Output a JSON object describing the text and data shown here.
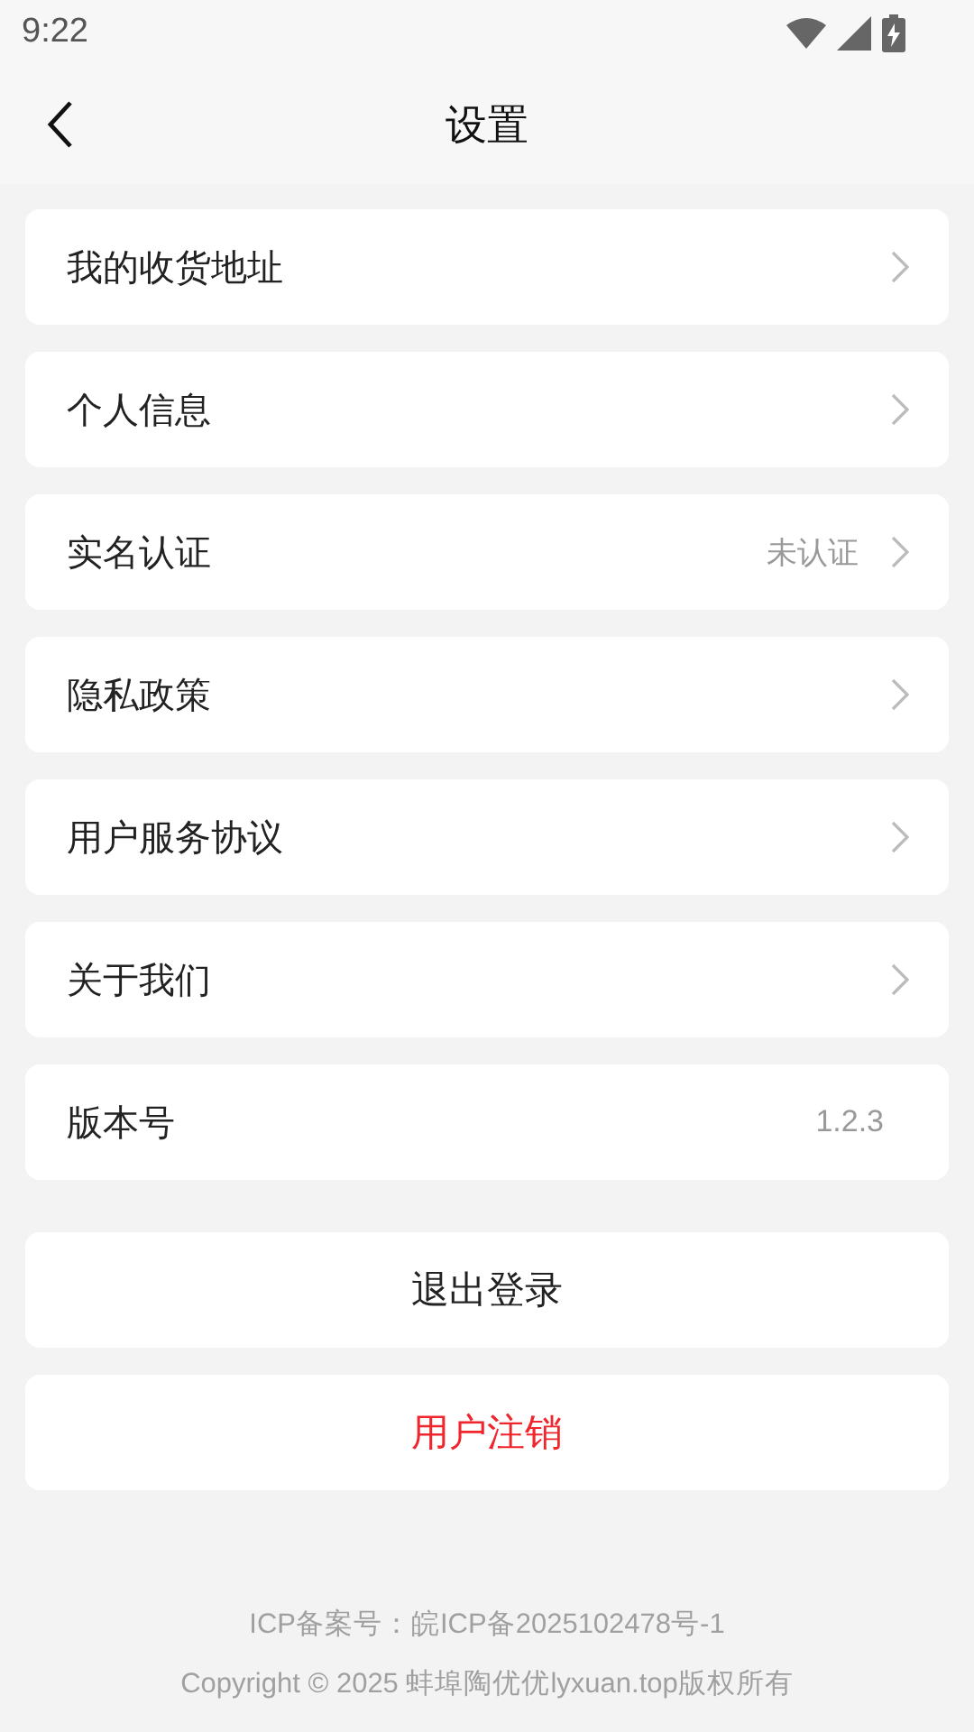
{
  "status_bar": {
    "time": "9:22"
  },
  "header": {
    "title": "设置"
  },
  "items": [
    {
      "kind": "link",
      "label": "我的收货地址"
    },
    {
      "kind": "link",
      "label": "个人信息"
    },
    {
      "kind": "link",
      "label": "实名认证",
      "value": "未认证"
    },
    {
      "kind": "link",
      "label": "隐私政策"
    },
    {
      "kind": "link",
      "label": "用户服务协议"
    },
    {
      "kind": "link",
      "label": "关于我们"
    },
    {
      "kind": "info",
      "label": "版本号",
      "value": "1.2.3"
    }
  ],
  "buttons": [
    {
      "kind": "normal",
      "label": "退出登录"
    },
    {
      "kind": "danger",
      "label": "用户注销"
    }
  ],
  "footer": [
    "ICP备案号：皖ICP备2025102478号-1",
    "Copyright © 2025 蚌埠陶优优lyxuan.top版权所有"
  ]
}
